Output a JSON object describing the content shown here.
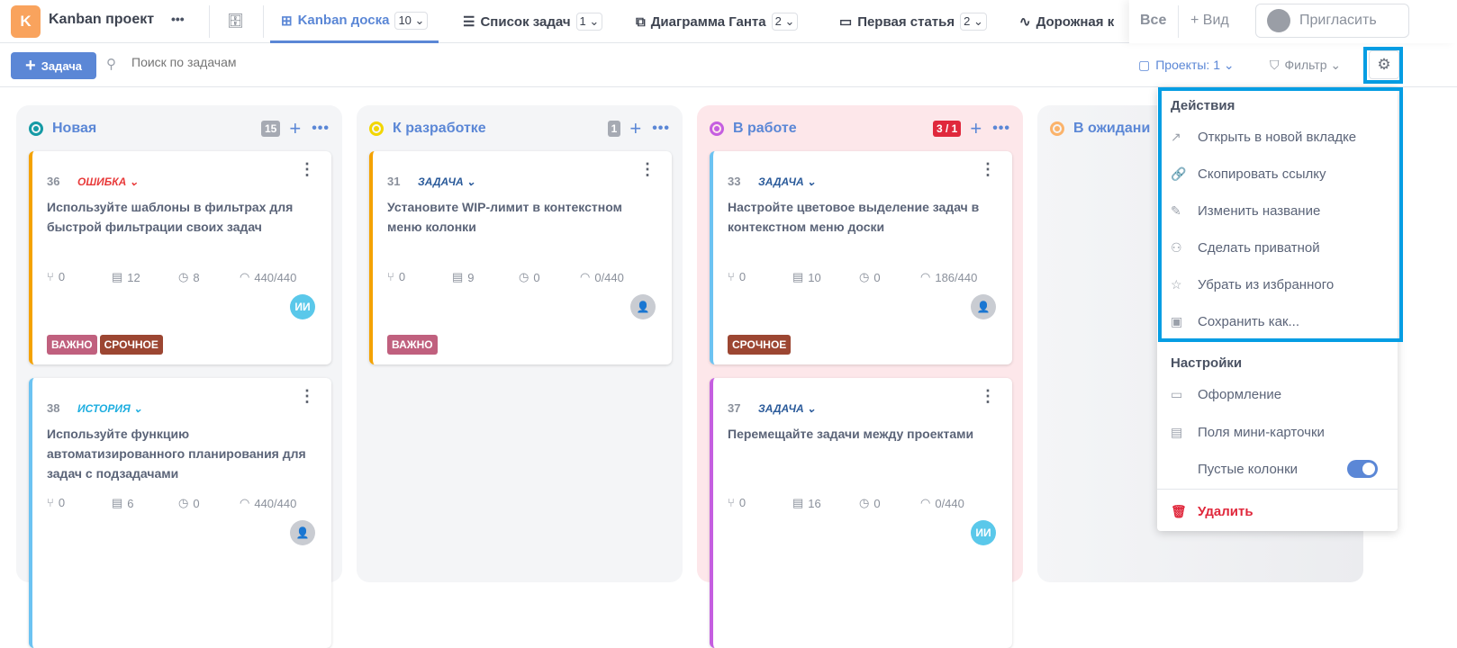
{
  "header": {
    "logo_letter": "K",
    "project": "Kanban проект",
    "more": "•••",
    "tabs": [
      {
        "label": "Kanban доска",
        "count": "10 ⌄",
        "icon": "kanban-icon",
        "active": true
      },
      {
        "label": "Список задач",
        "count": "1 ⌄",
        "icon": "list-icon"
      },
      {
        "label": "Диаграмма Ганта",
        "count": "2 ⌄",
        "icon": "gantt-icon"
      },
      {
        "label": "Первая статья",
        "count": "2 ⌄",
        "icon": "document-icon"
      },
      {
        "label": "Дорожная к",
        "icon": "roadmap-icon"
      }
    ],
    "all": "Все",
    "add_view": "+ Вид",
    "invite": "Пригласить"
  },
  "toolbar": {
    "add_task": "Задача",
    "search_placeholder": "Поиск по задачам",
    "projects": "Проекты: 1 ⌄",
    "filter": "Фильтр ⌄"
  },
  "columns": [
    {
      "name": "Новая",
      "count": "15",
      "color": "#159aa5"
    },
    {
      "name": "К разработке",
      "count": "1",
      "color": "#f2d600"
    },
    {
      "name": "В работе",
      "count": "3 / 1",
      "color": "#c55ee0",
      "count_color": "#e0283c",
      "bg": "#fde7ea"
    },
    {
      "name": "В ожидани",
      "color": "#fbb36b"
    }
  ],
  "cards": [
    {
      "num": "36",
      "type": "ОШИБКА ⌄",
      "type_color": "#e83a3a",
      "stripe": "#f4a200",
      "title": "Используйте шаблоны в фильтрах для быстрой фильтрации своих задач",
      "subtasks": "0",
      "comments": "12",
      "time": "8",
      "estimate": "440/440",
      "avatar": "ИИ",
      "tags": [
        "ВАЖНО",
        "СРОЧНОЕ"
      ]
    },
    {
      "num": "38",
      "type": "ИСТОРИЯ ⌄",
      "type_color": "#1eaee0",
      "stripe": "#6cc3f2",
      "title": "Используйте функцию автоматизированного планирования для задач с подзадачами",
      "subtasks": "0",
      "comments": "6",
      "time": "0",
      "estimate": "440/440",
      "avatar": "",
      "tags": []
    },
    {
      "num": "31",
      "type": "ЗАДАЧА ⌄",
      "type_color": "#2a5a9a",
      "stripe": "#f4a200",
      "title": "Установите WIP-лимит в контекстном меню колонки",
      "subtasks": "0",
      "comments": "9",
      "time": "0",
      "estimate": "0/440",
      "avatar": "",
      "tags": [
        "ВАЖНО"
      ]
    },
    {
      "num": "33",
      "type": "ЗАДАЧА ⌄",
      "type_color": "#2a5a9a",
      "stripe": "#6cc3f2",
      "title": "Настройте цветовое выделение задач в контекстном меню доски",
      "subtasks": "0",
      "comments": "10",
      "time": "0",
      "estimate": "186/440",
      "avatar": "",
      "tags": [
        "СРОЧНОЕ"
      ]
    },
    {
      "num": "37",
      "type": "ЗАДАЧА ⌄",
      "type_color": "#2a5a9a",
      "stripe": "#c55ee0",
      "title": "Перемещайте задачи между проектами",
      "subtasks": "0",
      "comments": "16",
      "time": "0",
      "estimate": "0/440",
      "avatar": "ИИ",
      "tags": []
    }
  ],
  "tag_colors": {
    "ВАЖНО": "#c0607e",
    "СРОЧНОЕ": "#9c4632"
  },
  "menu": {
    "actions_header": "Действия",
    "actions": [
      {
        "label": "Открыть в новой вкладке",
        "icon": "external-link-icon"
      },
      {
        "label": "Скопировать ссылку",
        "icon": "link-icon"
      },
      {
        "label": "Изменить название",
        "icon": "pencil-icon"
      },
      {
        "label": "Сделать приватной",
        "icon": "user-lock-icon"
      },
      {
        "label": "Убрать из избранного",
        "icon": "star-icon"
      },
      {
        "label": "Сохранить как...",
        "icon": "save-icon"
      }
    ],
    "settings_header": "Настройки",
    "settings": [
      {
        "label": "Оформление",
        "icon": "appearance-icon"
      },
      {
        "label": "Поля мини-карточки",
        "icon": "card-fields-icon"
      }
    ],
    "empty_columns": "Пустые колонки",
    "empty_columns_on": true,
    "delete": "Удалить"
  },
  "colors": {
    "accent": "#5b87d6",
    "highlight": "#049de3",
    "danger": "#e0283c"
  }
}
